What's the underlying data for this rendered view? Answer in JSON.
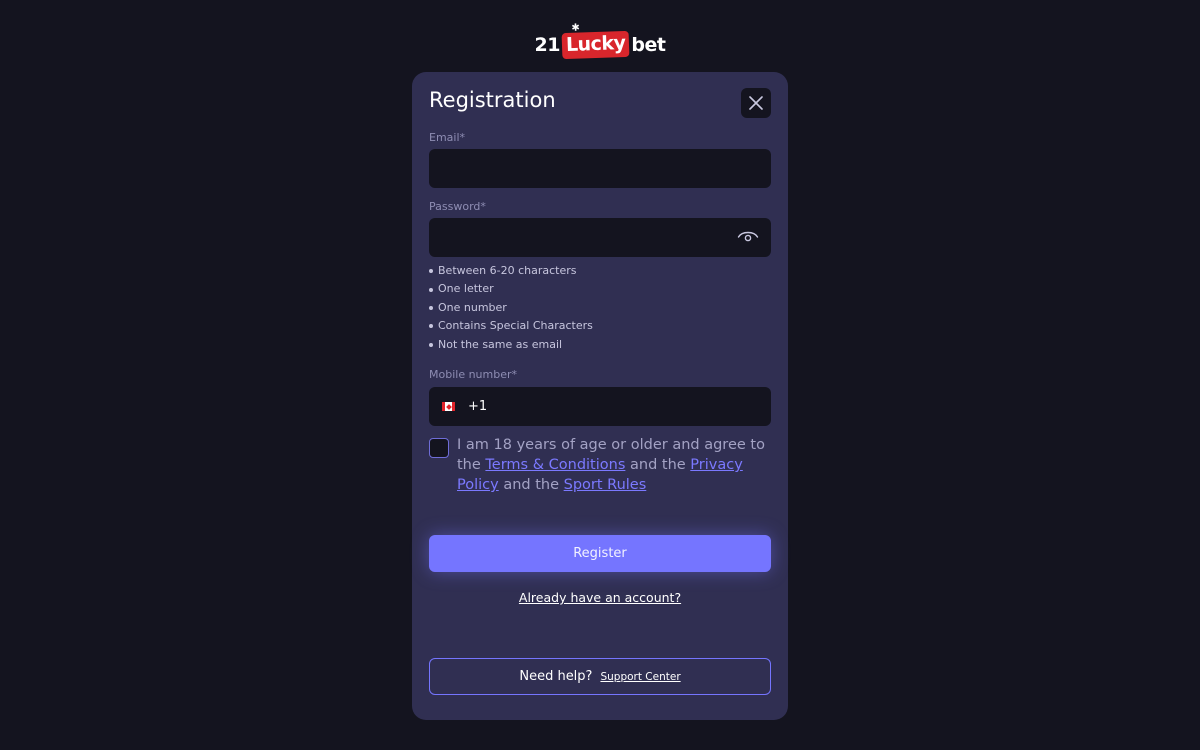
{
  "logo": {
    "num": "21",
    "lucky": "Lucky",
    "bet": "bet"
  },
  "modal": {
    "title": "Registration",
    "close_icon": "close-icon"
  },
  "email": {
    "label": "Email*",
    "value": "",
    "placeholder": ""
  },
  "password": {
    "label": "Password*",
    "value": "",
    "placeholder": "",
    "toggle_icon": "eye-icon",
    "rules": [
      "Between 6-20 characters",
      "One letter",
      "One number",
      "Contains Special Characters",
      "Not the same as email"
    ]
  },
  "mobile": {
    "label": "Mobile number*",
    "country_flag": "canada-flag-icon",
    "code": "+1",
    "value": ""
  },
  "consent": {
    "checked": false,
    "text_1": "I am 18 years of age or older and agree to the",
    "terms_link": "Terms & Conditions",
    "text_2": "and the",
    "privacy_link": "Privacy Policy",
    "text_3": "and the",
    "sport_link": "Sport Rules"
  },
  "actions": {
    "register_label": "Register",
    "login_link": "Already have an account?"
  },
  "help": {
    "question": "Need help?",
    "link": "Support Center"
  },
  "colors": {
    "background": "#14141f",
    "modal": "#302f52",
    "accent": "#7575ff",
    "logo_red": "#d8262c"
  }
}
